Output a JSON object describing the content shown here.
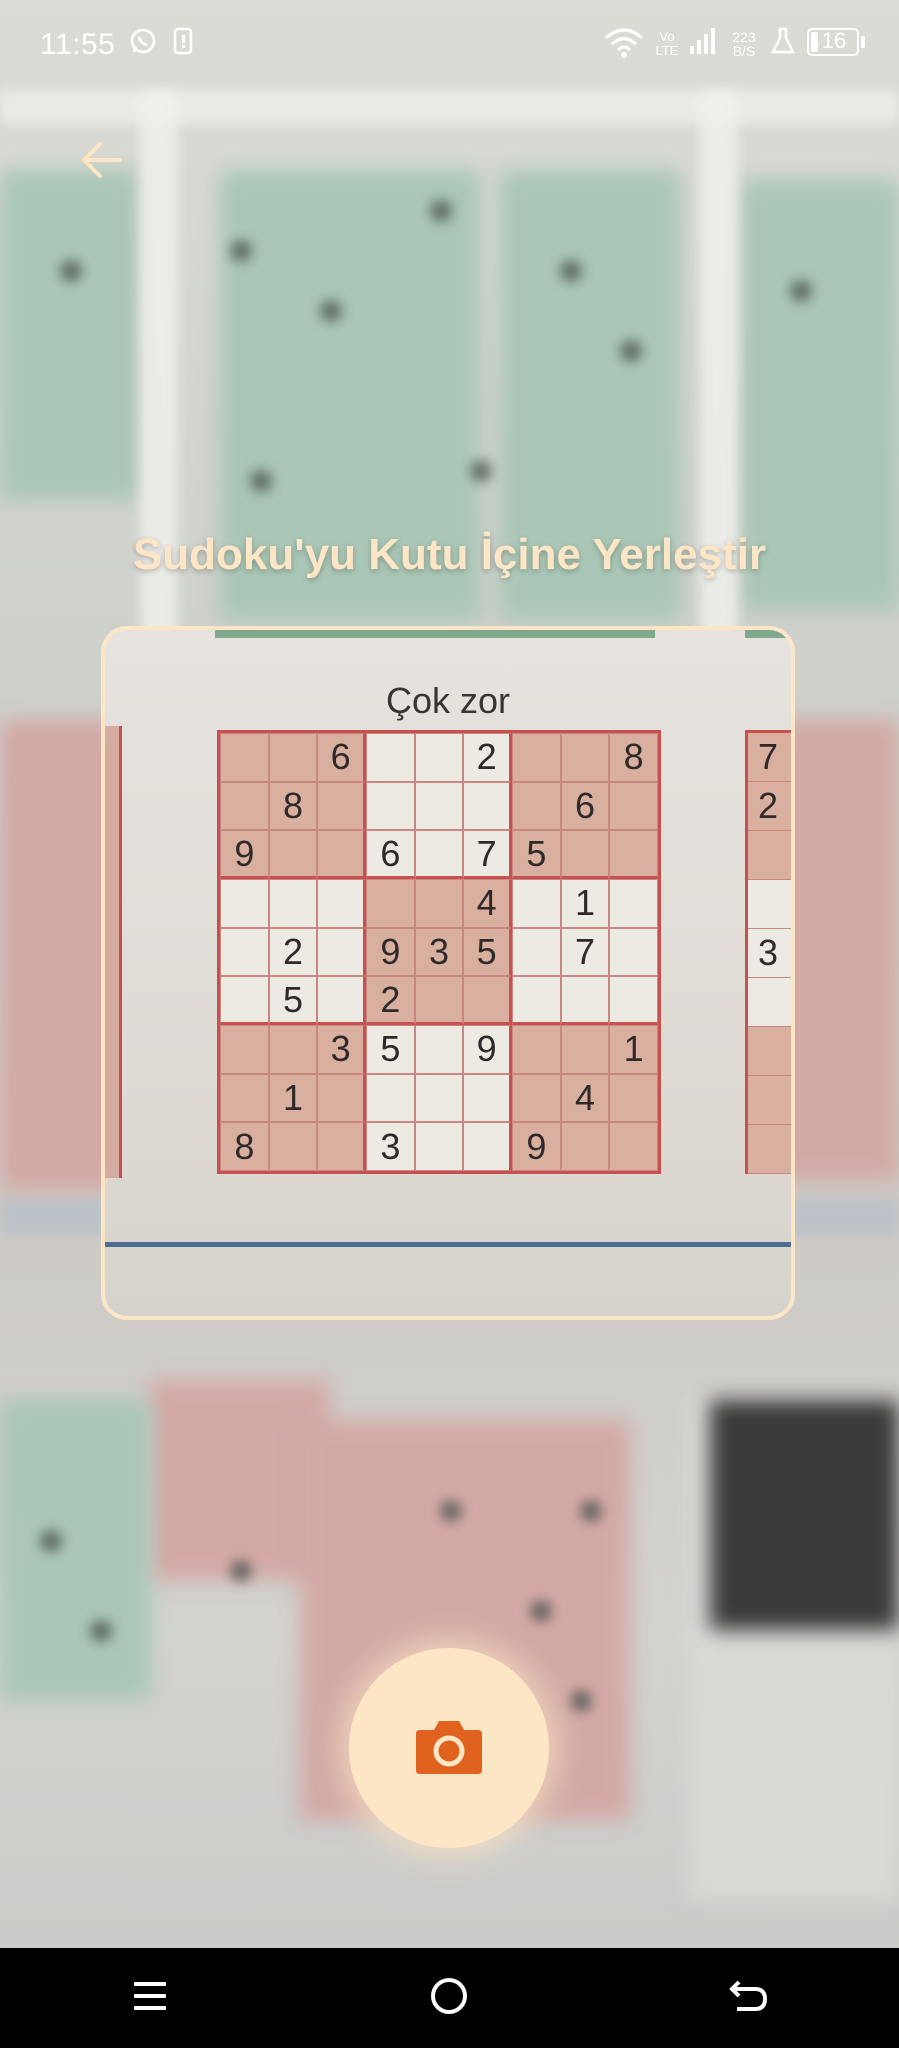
{
  "status": {
    "time": "11:55",
    "network_label": "Vo LTE",
    "speed_value": "223",
    "speed_unit": "B/S",
    "battery": "16",
    "battery_level": 0.16
  },
  "title": "Sudoku'yu Kutu İçine Yerleştir",
  "puzzle": {
    "label": "Çok zor",
    "rows": [
      [
        "",
        "",
        "6",
        "",
        "",
        "2",
        "",
        "",
        "8"
      ],
      [
        "",
        "8",
        "",
        "",
        "",
        "",
        "",
        "6",
        ""
      ],
      [
        "9",
        "",
        "",
        "6",
        "",
        "7",
        "5",
        "",
        ""
      ],
      [
        "",
        "",
        "",
        "",
        "",
        "4",
        "",
        "1",
        ""
      ],
      [
        "",
        "2",
        "",
        "9",
        "3",
        "5",
        "",
        "7",
        ""
      ],
      [
        "",
        "5",
        "",
        "2",
        "",
        "",
        "",
        "",
        ""
      ],
      [
        "",
        "",
        "3",
        "5",
        "",
        "9",
        "",
        "",
        "1"
      ],
      [
        "",
        "1",
        "",
        "",
        "",
        "",
        "",
        "4",
        ""
      ],
      [
        "8",
        "",
        "",
        "3",
        "",
        "",
        "9",
        "",
        ""
      ]
    ],
    "right_column": [
      "7",
      "2",
      "",
      "",
      "3",
      "",
      "",
      "",
      ""
    ]
  },
  "icons": {
    "back": "arrow-left-icon",
    "capture": "camera-icon",
    "nav_menu": "menu-icon",
    "nav_home": "home-circle-icon",
    "nav_back": "back-icon"
  },
  "colors": {
    "accent": "#fde6c5",
    "camera": "#e0621f"
  }
}
